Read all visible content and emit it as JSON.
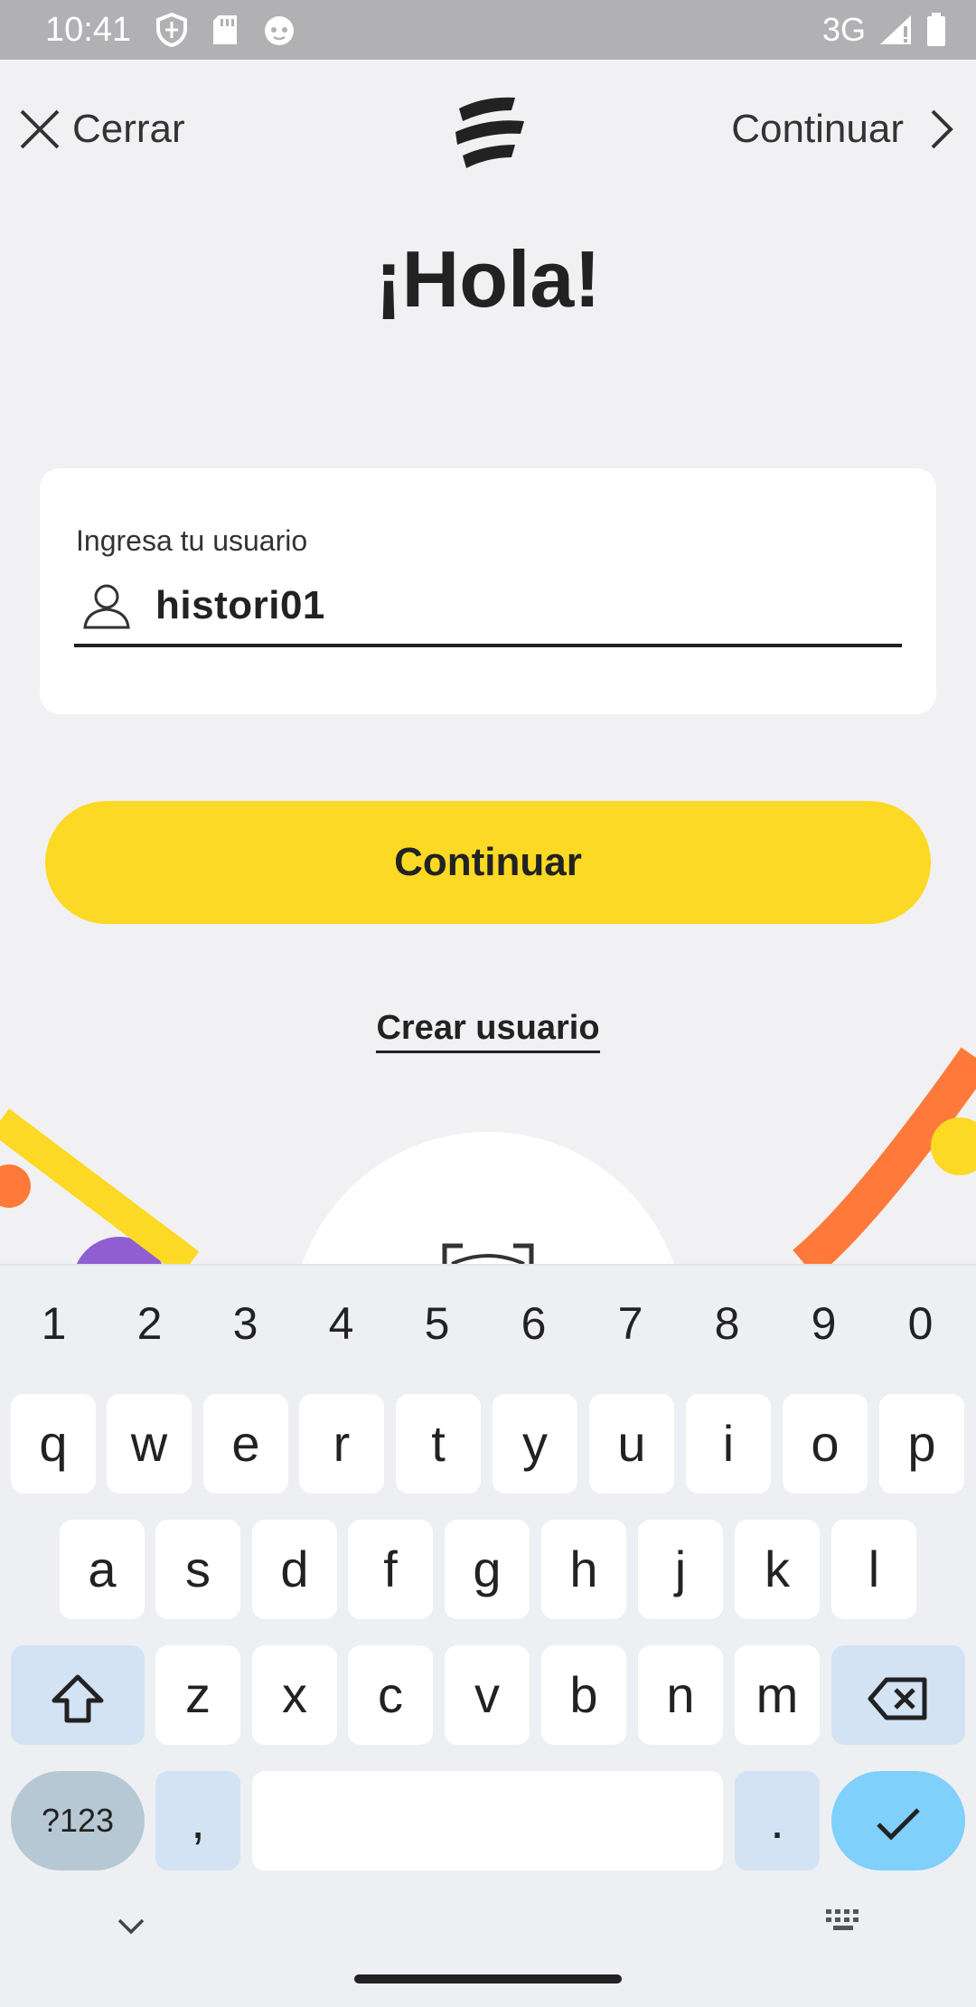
{
  "status_bar": {
    "time": "10:41",
    "network": "3G",
    "icons": [
      "shield-icon",
      "sd-card-icon",
      "cat-face-icon",
      "signal-icon",
      "battery-icon"
    ]
  },
  "nav": {
    "close_label": "Cerrar",
    "continue_label": "Continuar",
    "close_icon": "close-icon",
    "continue_icon": "chevron-right-icon",
    "logo_icon": "brand-logo"
  },
  "greeting": "¡Hola!",
  "form": {
    "username_label": "Ingresa tu usuario",
    "username_value": "histori01",
    "field_icon": "user-icon"
  },
  "primary_button": "Continuar",
  "create_user_link": "Crear usuario",
  "colors": {
    "accent_yellow": "#fcd924",
    "decor_orange": "#ff7a3a",
    "decor_purple": "#8f5fd1",
    "background": "#f1f1f3"
  },
  "keyboard": {
    "numbers": [
      "1",
      "2",
      "3",
      "4",
      "5",
      "6",
      "7",
      "8",
      "9",
      "0"
    ],
    "row1": [
      "q",
      "w",
      "e",
      "r",
      "t",
      "y",
      "u",
      "i",
      "o",
      "p"
    ],
    "row2": [
      "a",
      "s",
      "d",
      "f",
      "g",
      "h",
      "j",
      "k",
      "l"
    ],
    "row3": [
      "z",
      "x",
      "c",
      "v",
      "b",
      "n",
      "m"
    ],
    "mode_key": "?123",
    "comma_key": ",",
    "period_key": ".",
    "shift_icon": "shift-icon",
    "backspace_icon": "backspace-icon",
    "enter_icon": "checkmark-icon"
  },
  "system_nav": {
    "hide_keyboard_icon": "chevron-down-icon",
    "keyboard_switch_icon": "keyboard-icon"
  }
}
